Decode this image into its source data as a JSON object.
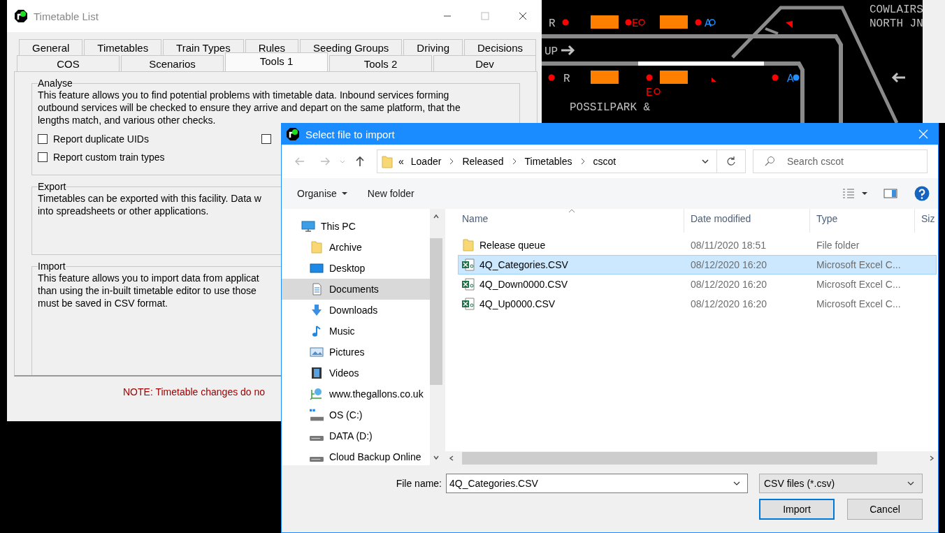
{
  "background": {
    "labels": [
      {
        "text": "R",
        "color": "#c0c0c0"
      },
      {
        "text": "E",
        "color": "#ff0000"
      },
      {
        "text": "A",
        "color": "#1e90ff"
      },
      {
        "text": "UP",
        "color": "#c0c0c0"
      },
      {
        "text": "R",
        "color": "#c0c0c0"
      },
      {
        "text": "A",
        "color": "#1e90ff"
      },
      {
        "text": "E",
        "color": "#ff0000"
      },
      {
        "text": "POSSILPARK &",
        "color": "#c0c0c0"
      },
      {
        "text": "COWLAIRS",
        "color": "#c0c0c0"
      },
      {
        "text": "NORTH JN",
        "color": "#c0c0c0"
      }
    ]
  },
  "timetable_window": {
    "title": "Timetable List",
    "tabs_row_1": [
      {
        "label": "General",
        "selected": false
      },
      {
        "label": "Timetables",
        "selected": false
      },
      {
        "label": "Train Types",
        "selected": false
      },
      {
        "label": "Rules",
        "selected": false
      },
      {
        "label": "Seeding Groups",
        "selected": false
      },
      {
        "label": "Driving",
        "selected": false
      },
      {
        "label": "Decisions",
        "selected": false
      }
    ],
    "tabs_row_2": [
      {
        "label": "COS",
        "selected": false
      },
      {
        "label": "Scenarios",
        "selected": false
      },
      {
        "label": "Tools 1",
        "selected": true
      },
      {
        "label": "Tools 2",
        "selected": false
      },
      {
        "label": "Dev",
        "selected": false
      }
    ],
    "analyse": {
      "title": "Analyse",
      "lines": [
        "This feature allows you to find potential problems with timetable data. Inbound services forming",
        "outbound services will be checked to ensure they arrive and depart on the same platform, that the",
        "lengths match, and various other checks."
      ],
      "checkboxes": [
        {
          "label": "Report duplicate UIDs",
          "checked": false
        },
        {
          "checked": false
        },
        {
          "label": "Report custom train types",
          "checked": false
        }
      ]
    },
    "export": {
      "title": "Export",
      "lines": [
        "Timetables can be exported with this facility. Data w",
        "into spreadsheets or other applications."
      ]
    },
    "import": {
      "title": "Import",
      "lines": [
        "This feature allows you to import data from applicat",
        "than using the in-built timetable editor to use those",
        "must be saved in CSV format."
      ]
    },
    "note": "NOTE: Timetable changes do no"
  },
  "file_dialog": {
    "title": "Select file to import",
    "overflow": "«",
    "path": [
      "Loader",
      "Released",
      "Timetables",
      "cscot"
    ],
    "search": {
      "placeholder": "Search cscot"
    },
    "toolbar": {
      "organise": "Organise",
      "new_folder": "New folder"
    },
    "sidebar": [
      {
        "label": "This PC",
        "kind": "pc",
        "selected": false,
        "children": [
          {
            "label": "Archive",
            "kind": "folder",
            "selected": false
          },
          {
            "label": "Desktop",
            "kind": "desktop",
            "selected": false
          },
          {
            "label": "Documents",
            "kind": "documents",
            "selected": true
          },
          {
            "label": "Downloads",
            "kind": "downloads",
            "selected": false
          },
          {
            "label": "Music",
            "kind": "music",
            "selected": false
          },
          {
            "label": "Pictures",
            "kind": "pictures",
            "selected": false
          },
          {
            "label": "Videos",
            "kind": "videos",
            "selected": false
          },
          {
            "label": "www.thegallons.co.uk",
            "kind": "web",
            "selected": false
          },
          {
            "label": "OS (C:)",
            "kind": "os-drive",
            "selected": false
          },
          {
            "label": "DATA (D:)",
            "kind": "drive",
            "selected": false
          },
          {
            "label": "Cloud Backup Online",
            "kind": "drive",
            "selected": false
          }
        ]
      }
    ],
    "columns": [
      "Name",
      "Date modified",
      "Type",
      "Siz"
    ],
    "rows": [
      {
        "name": "Release queue",
        "date": "08/11/2020 18:51",
        "type": "File folder",
        "kind": "folder",
        "selected": false
      },
      {
        "name": "4Q_Categories.CSV",
        "date": "08/12/2020 16:20",
        "type": "Microsoft Excel C...",
        "kind": "excel",
        "selected": true
      },
      {
        "name": "4Q_Down0000.CSV",
        "date": "08/12/2020 16:20",
        "type": "Microsoft Excel C...",
        "kind": "excel",
        "selected": false
      },
      {
        "name": "4Q_Up0000.CSV",
        "date": "08/12/2020 16:20",
        "type": "Microsoft Excel C...",
        "kind": "excel",
        "selected": false
      }
    ],
    "file_name": {
      "label": "File name:",
      "value": "4Q_Categories.CSV"
    },
    "filter": "CSV files (*.csv)",
    "buttons": [
      "Import",
      "Cancel"
    ]
  }
}
